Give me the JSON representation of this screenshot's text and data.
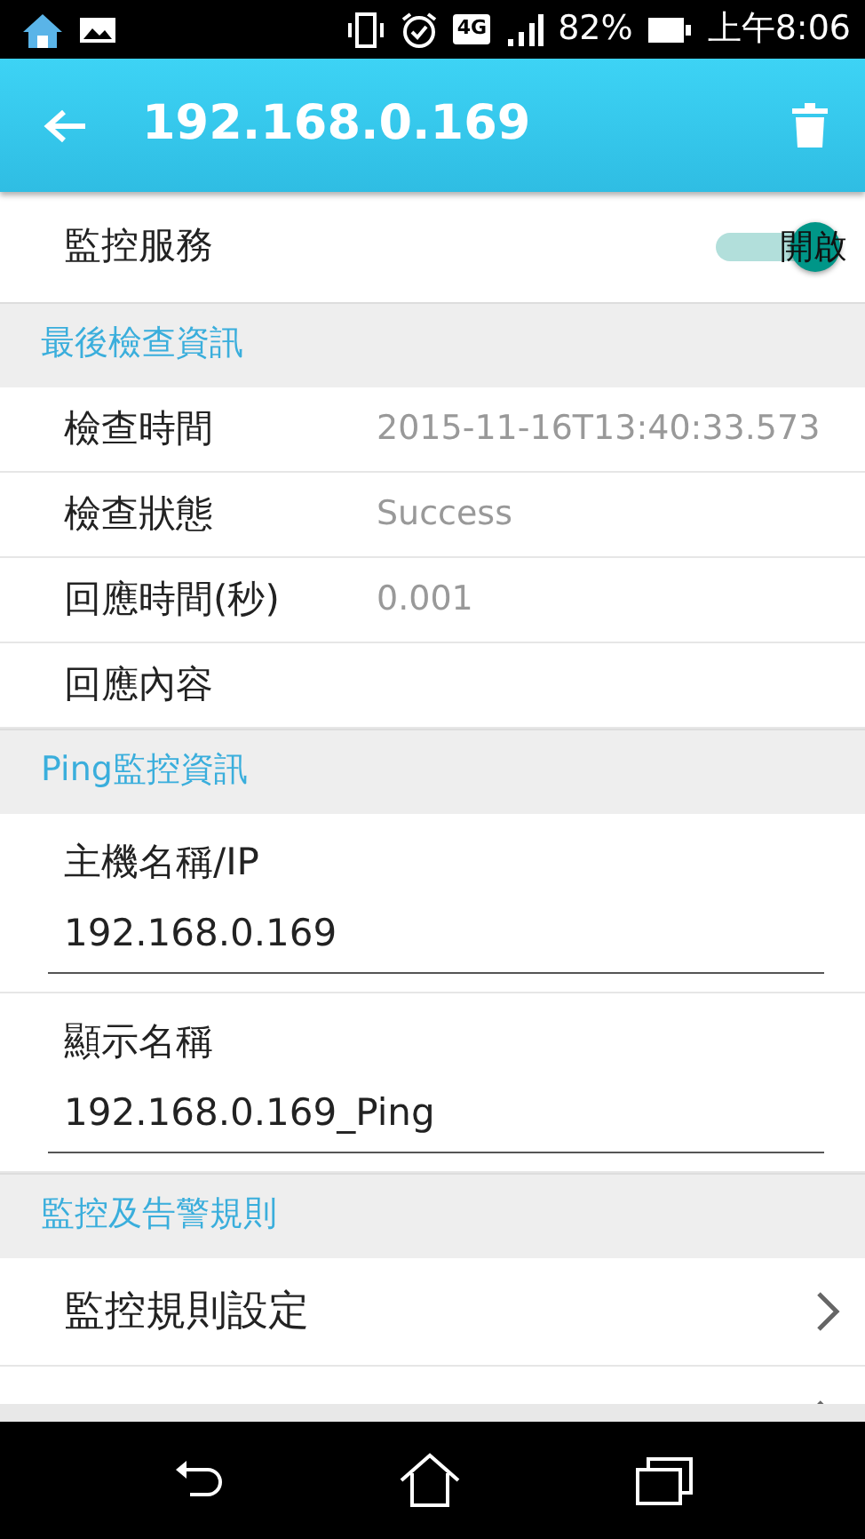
{
  "status_bar": {
    "network": "4G",
    "battery": "82%",
    "time": "上午8:06"
  },
  "app_bar": {
    "title": "192.168.0.169"
  },
  "monitor_service": {
    "label": "監控服務",
    "switch_label": "開啟",
    "on": true
  },
  "sections": [
    {
      "title": "最後檢查資訊",
      "items": [
        {
          "kind": "info",
          "label": "檢查時間",
          "value": "2015-11-16T13:40:33.573"
        },
        {
          "kind": "info",
          "label": "檢查狀態",
          "value": "Success"
        },
        {
          "kind": "info",
          "label": "回應時間(秒)",
          "value": "0.001"
        },
        {
          "kind": "info",
          "label": "回應內容"
        }
      ]
    },
    {
      "title": "Ping監控資訊",
      "items": [
        {
          "kind": "field",
          "label": "主機名稱/IP",
          "value": "192.168.0.169"
        },
        {
          "kind": "field",
          "label": "顯示名稱",
          "value": "192.168.0.169_Ping"
        }
      ]
    },
    {
      "title": "監控及告警規則",
      "items": [
        {
          "kind": "link",
          "label": "監控規則設定"
        },
        {
          "kind": "link"
        }
      ]
    }
  ]
}
